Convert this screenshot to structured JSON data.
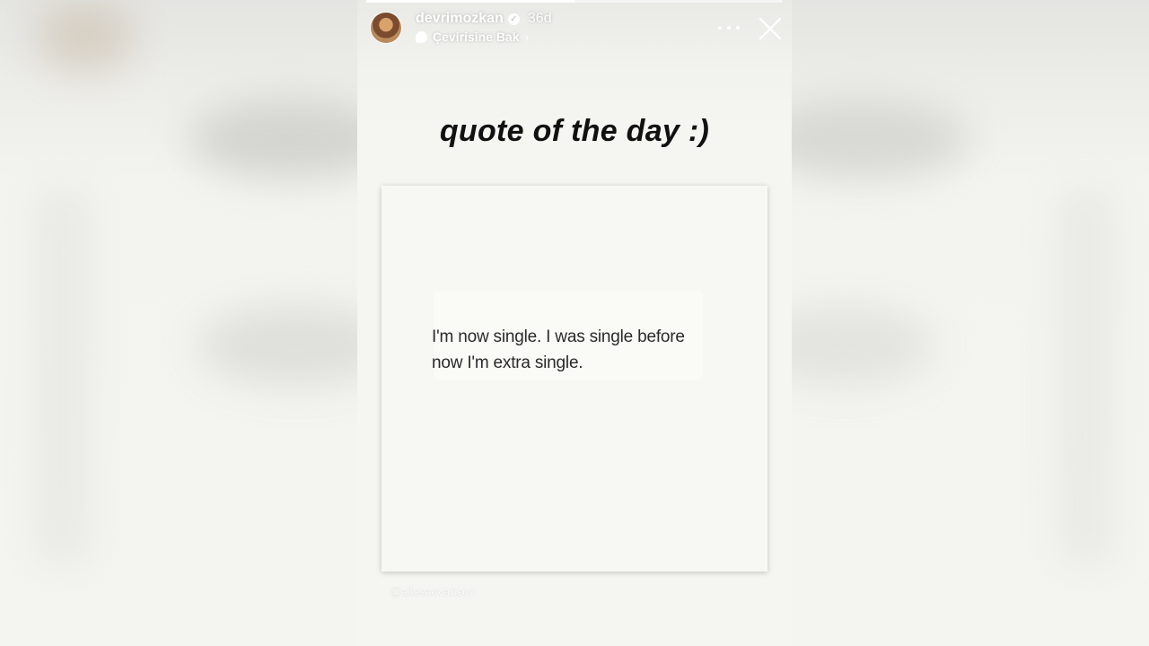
{
  "story": {
    "progress": 0.5,
    "user": {
      "username": "devrimozkan",
      "verified": true,
      "time": "36d"
    },
    "translate": {
      "label": "Çevirisine Bak",
      "chevron": "›"
    },
    "icons": {
      "more": "more-options-icon",
      "close": "close-icon",
      "translate": "speech-bubble-icon",
      "verified": "verified-badge-icon"
    },
    "title": "quote of the day :)",
    "quote_card": {
      "line1": "I'm now single. I was single before",
      "line2": "now I'm extra single."
    },
    "credit": "@alissaevanson"
  },
  "colors": {
    "text_dark": "#111111",
    "card_bg": "#f7f7f3",
    "overlay_white": "#ffffff"
  }
}
